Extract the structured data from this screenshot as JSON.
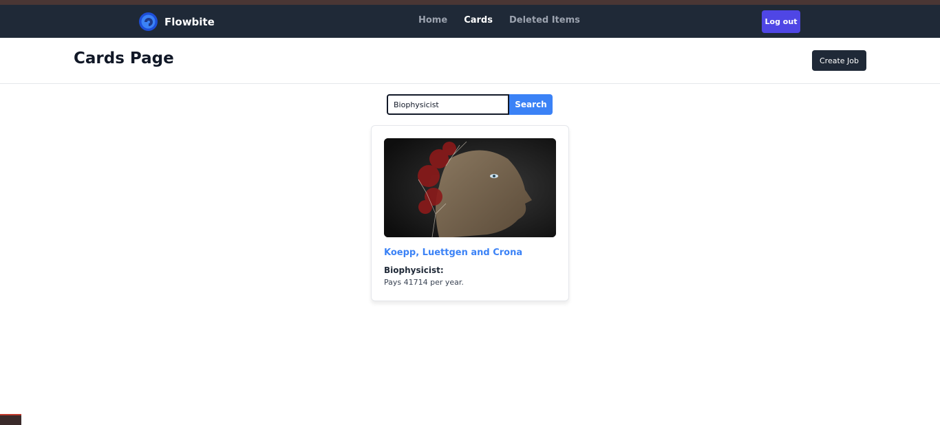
{
  "navbar": {
    "brand": "Flowbite",
    "links": [
      {
        "label": "Home",
        "active": false
      },
      {
        "label": "Cards",
        "active": true
      },
      {
        "label": "Deleted Items",
        "active": false
      }
    ],
    "logout_label": "Log out"
  },
  "header": {
    "title": "Cards Page",
    "create_label": "Create Job"
  },
  "search": {
    "value": "Biophysicist",
    "button_label": "Search"
  },
  "cards": [
    {
      "company": "Koepp, Luettgen and Crona",
      "role": "Biophysicist:",
      "pay": "Pays 41714 per year.",
      "image": "face-tree-artwork"
    }
  ],
  "colors": {
    "navbar": "#1f2937",
    "logout": "#4f46e5",
    "accent": "#3b82f6"
  }
}
